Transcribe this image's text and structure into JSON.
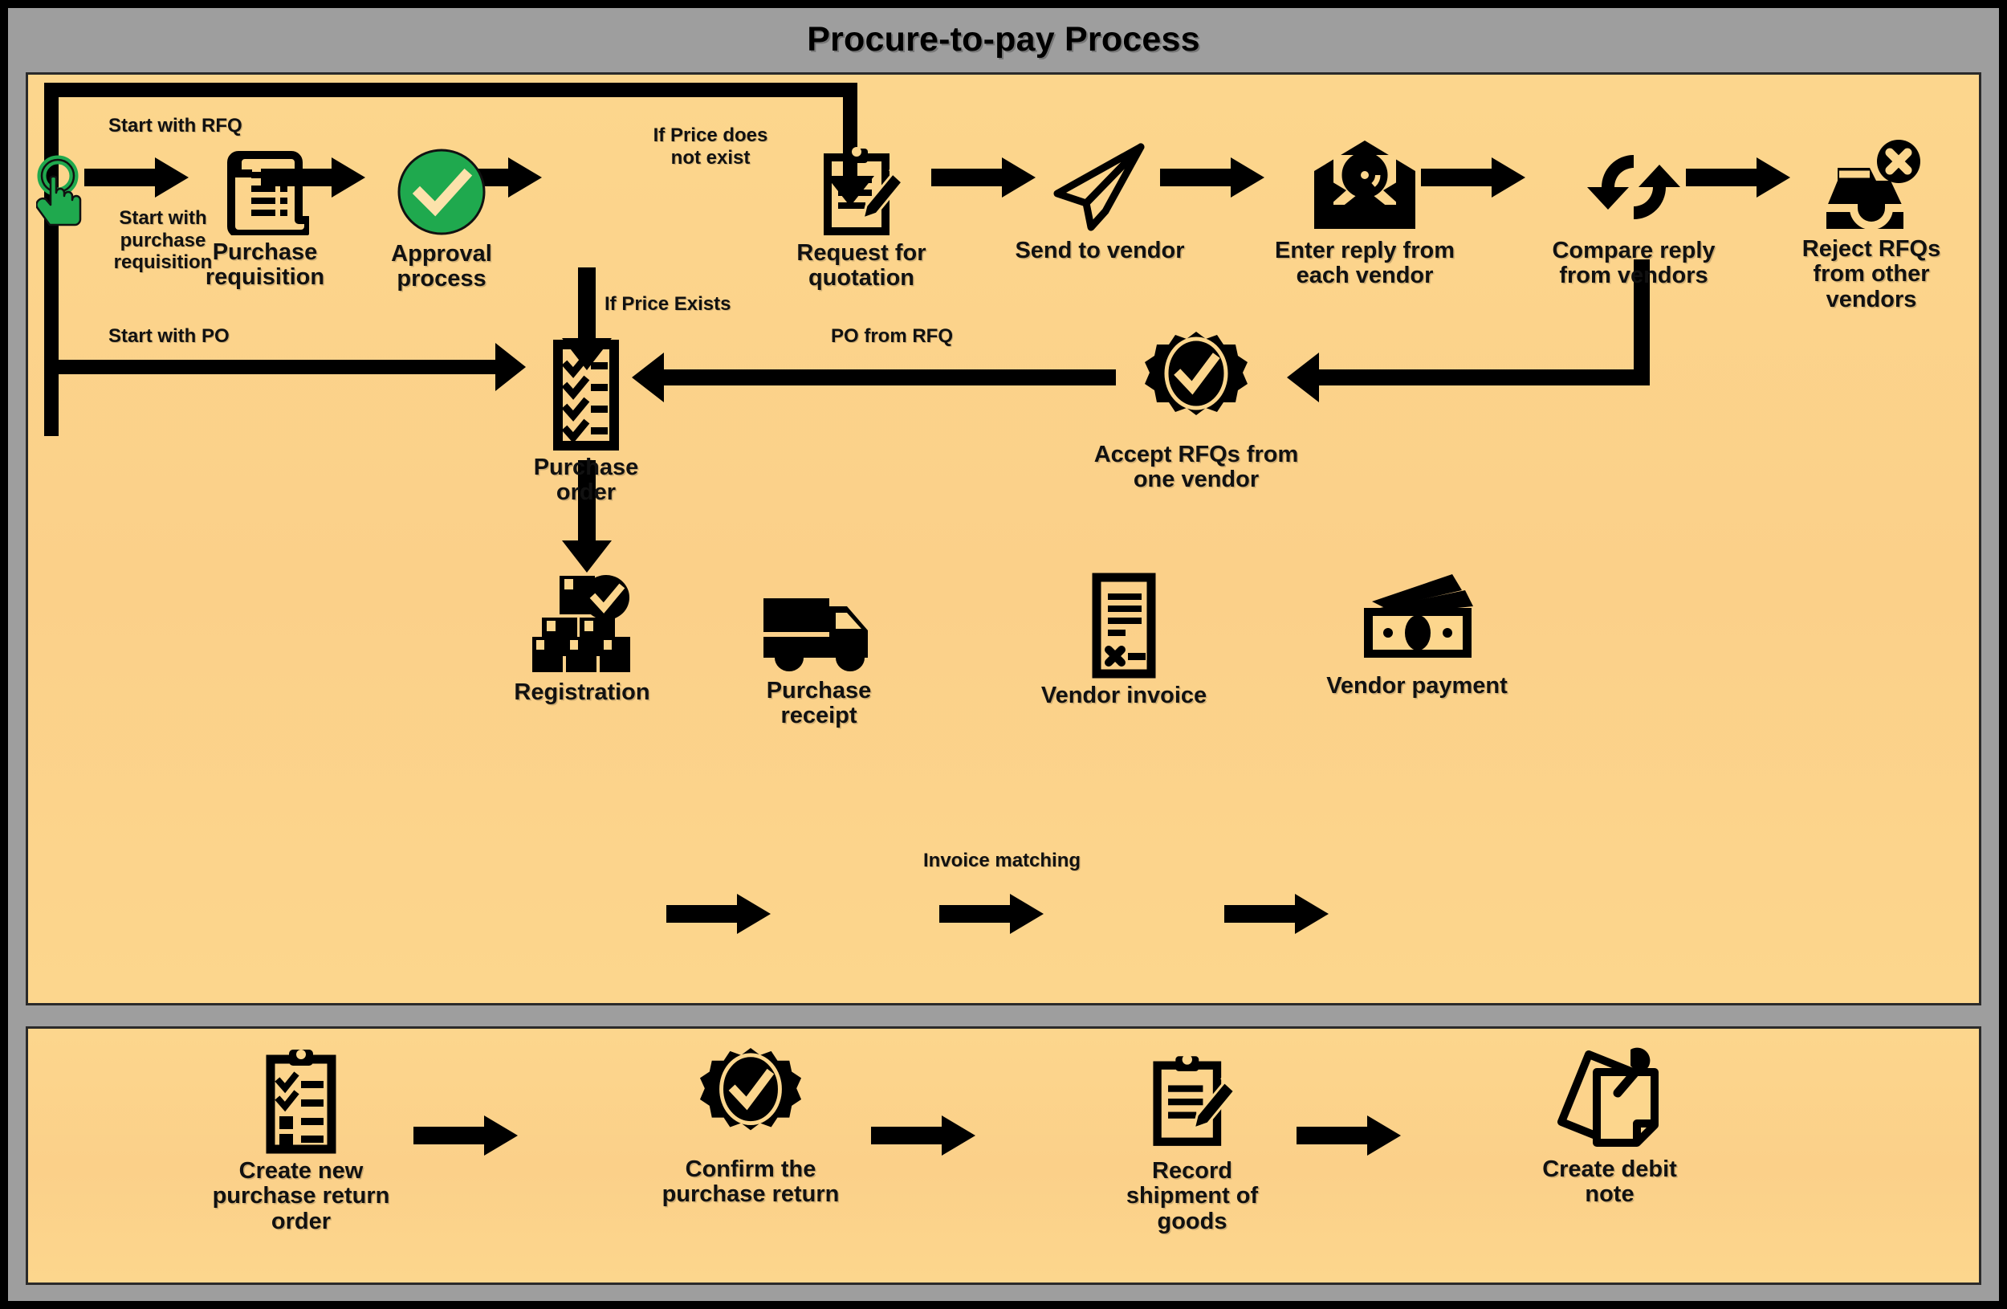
{
  "title": "Procure-to-pay Process",
  "colors": {
    "frame": "#000000",
    "background_gray": "#9e9e9e",
    "panel_fill": "#fbd089",
    "panel_border": "#2a2a2a",
    "accent_green": "#1fa94e",
    "ink": "#000000"
  },
  "panels": [
    {
      "id": "main",
      "name": "procure-to-pay-main-flow"
    },
    {
      "id": "return",
      "name": "purchase-return-flow"
    }
  ],
  "main_flow": {
    "nodes": [
      {
        "id": "start",
        "icon": "pointing-hand-icon",
        "label": ""
      },
      {
        "id": "purchase_req",
        "icon": "receipt-scroll-icon",
        "label": "Purchase\nrequisition"
      },
      {
        "id": "approval",
        "icon": "green-check-circle-icon",
        "label": "Approval\nprocess"
      },
      {
        "id": "rfq",
        "icon": "clipboard-pencil-icon",
        "label": "Request for\nquotation"
      },
      {
        "id": "send_vendor",
        "icon": "paper-plane-icon",
        "label": "Send to vendor"
      },
      {
        "id": "enter_reply",
        "icon": "email-envelope-icon",
        "label": "Enter reply from\neach vendor"
      },
      {
        "id": "compare_reply",
        "icon": "refresh-cycle-icon",
        "label": "Compare reply\nfrom vendors"
      },
      {
        "id": "reject_rfq",
        "icon": "inbox-reject-icon",
        "label": "Reject RFQs\nfrom other\nvendors"
      },
      {
        "id": "purchase_order",
        "icon": "checklist-icon",
        "label": "Purchase order"
      },
      {
        "id": "accept_rfq",
        "icon": "verified-badge-icon",
        "label": "Accept RFQs from\none vendor"
      },
      {
        "id": "registration",
        "icon": "boxes-check-icon",
        "label": "Registration"
      },
      {
        "id": "purchase_receipt",
        "icon": "delivery-truck-icon",
        "label": "Purchase\nreceipt"
      },
      {
        "id": "vendor_invoice",
        "icon": "invoice-document-icon",
        "label": "Vendor invoice"
      },
      {
        "id": "vendor_payment",
        "icon": "banknote-cash-icon",
        "label": "Vendor payment"
      }
    ],
    "edge_labels": [
      {
        "id": "start_rfq",
        "text": "Start with RFQ"
      },
      {
        "id": "start_req",
        "text": "Start with\npurchase\nrequisition"
      },
      {
        "id": "price_not_exist",
        "text": "If Price does\nnot exist"
      },
      {
        "id": "price_exists",
        "text": "If Price Exists"
      },
      {
        "id": "start_po",
        "text": "Start with PO"
      },
      {
        "id": "po_from_rfq",
        "text": "PO from RFQ"
      },
      {
        "id": "invoice_matching",
        "text": "Invoice matching"
      }
    ]
  },
  "return_flow": {
    "nodes": [
      {
        "id": "create_return",
        "icon": "clipboard-checklist-icon",
        "label": "Create new\npurchase return\norder"
      },
      {
        "id": "confirm_return",
        "icon": "verified-badge-icon",
        "label": "Confirm the\npurchase return"
      },
      {
        "id": "record_shipment",
        "icon": "clipboard-pencil-icon",
        "label": "Record\nshipment of\ngoods"
      },
      {
        "id": "debit_note",
        "icon": "pinned-note-icon",
        "label": "Create debit\nnote"
      }
    ]
  }
}
